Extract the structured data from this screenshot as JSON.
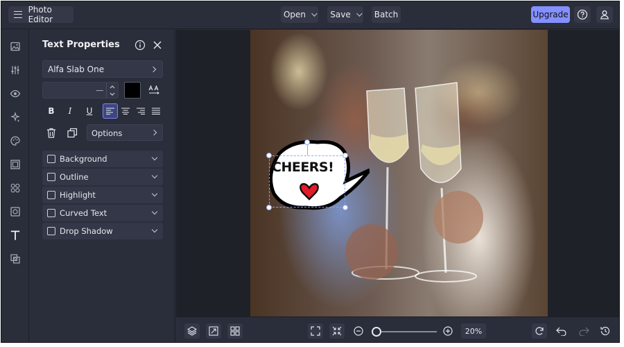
{
  "app": {
    "title": "Photo Editor"
  },
  "header": {
    "open_label": "Open",
    "save_label": "Save",
    "batch_label": "Batch",
    "upgrade_label": "Upgrade",
    "accent": "#8490ff"
  },
  "left_toolbar": {
    "items": [
      "image-icon",
      "sliders-icon",
      "eye-icon",
      "sparkle-icon",
      "palette-icon",
      "frame-icon",
      "shapes-icon",
      "texture-icon",
      "text-icon",
      "layers-overlay-icon"
    ],
    "active": "text-icon"
  },
  "panel": {
    "title": "Text Properties",
    "font_name": "Alfa Slab One",
    "font_size_value": "—",
    "text_color": "#000000",
    "options_label": "Options",
    "format_buttons": [
      "B",
      "I",
      "U"
    ],
    "alignment": "left",
    "effects": [
      {
        "label": "Background",
        "checked": false
      },
      {
        "label": "Outline",
        "checked": false
      },
      {
        "label": "Highlight",
        "checked": false
      },
      {
        "label": "Curved Text",
        "checked": false
      },
      {
        "label": "Drop Shadow",
        "checked": false
      }
    ]
  },
  "canvas": {
    "sticker_text": "CHEERS!"
  },
  "bottom_bar": {
    "zoom_label": "20%",
    "zoom_fraction": 0.2
  }
}
